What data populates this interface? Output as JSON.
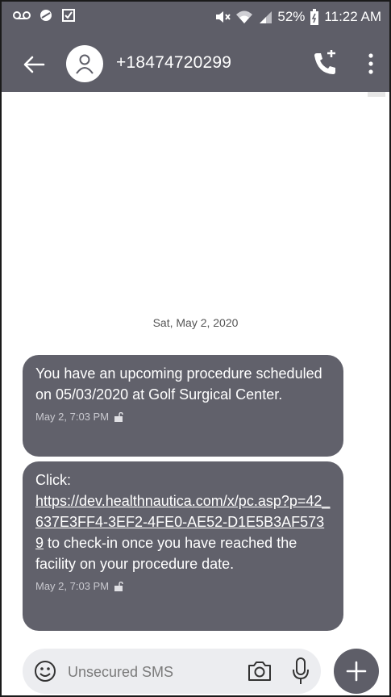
{
  "status_bar": {
    "battery": "52%",
    "time": "11:22 AM",
    "icons": [
      "voicemail-icon",
      "data-saver-icon",
      "checkbox-icon",
      "mute-icon",
      "wifi-icon",
      "signal-icon",
      "battery-icon"
    ]
  },
  "header": {
    "contact": "+18474720299",
    "icons": [
      "back-arrow-icon",
      "avatar-icon",
      "phone-icon",
      "more-vert-icon"
    ]
  },
  "conversation": {
    "date": "Sat, May 2, 2020",
    "messages": [
      {
        "text": "You have an upcoming procedure scheduled on 05/03/2020 at Golf Surgical Center.",
        "time": "May 2, 7:03 PM"
      },
      {
        "prefix": "Click: ",
        "link": "https://dev.healthnautica.com/x/pc.asp?p=42_637E3FF4-3EF2-4FE0-AE52-D1E5B3AF5739",
        "suffix": " to check-in once you have reached the facility on your procedure date.",
        "time": "May 2, 7:03 PM"
      }
    ]
  },
  "composer": {
    "placeholder": "Unsecured SMS",
    "icons": [
      "emoji-icon",
      "camera-icon",
      "mic-icon",
      "add-icon"
    ]
  },
  "colors": {
    "bar": "#5e5e68",
    "bubble": "#61616b",
    "composer_bg": "#ecedf0"
  }
}
